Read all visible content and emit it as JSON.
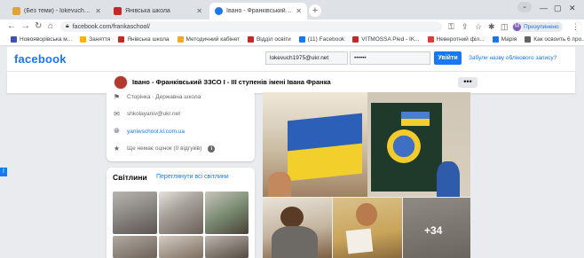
{
  "browser": {
    "tabs": [
      {
        "title": "(Без теми) - lokevuch1975@ukr.n",
        "active": false,
        "favicon_color": "#e5a234"
      },
      {
        "title": "Янівська школа",
        "active": false,
        "favicon_color": "#c62828"
      },
      {
        "title": "Івано - Франківський ЗЗСО І - І",
        "active": true,
        "favicon_color": "#1877f2"
      }
    ],
    "new_tab": "+",
    "url": "facebook.com/frankaschool/",
    "profile_initial": "M",
    "profile_label": "Призупинено",
    "bookmarks": [
      {
        "label": "Новояворівська м...",
        "color": "#3f51b5"
      },
      {
        "label": "Заняття",
        "color": "#ffb300"
      },
      {
        "label": "Янівська школа",
        "color": "#c62828"
      },
      {
        "label": "Методичний кабінет",
        "color": "#f9a825"
      },
      {
        "label": "Відділ освіти",
        "color": "#c62828"
      },
      {
        "label": "(11) Facebook",
        "color": "#1877f2"
      },
      {
        "label": "VITMOSSA Pled - IK...",
        "color": "#c62828"
      },
      {
        "label": "Неверотний філ...",
        "color": "#e53935"
      },
      {
        "label": "Марія",
        "color": "#1877f2"
      },
      {
        "label": "Как освоить 6 про...",
        "color": "#5f6368"
      }
    ]
  },
  "facebook": {
    "logo": "facebook",
    "email_value": "lokevuch1975@ukr.net",
    "password_value": "••••••",
    "login_label": "Увійти",
    "forgot_label": "Забули назву облікового запису?",
    "page_name": "Івано - Франківський ЗЗСО І - ІІІ ступенів імені Івана Франка",
    "more_label": "•••",
    "info": {
      "category": "Сторінка · Державна школа",
      "email": "shkolayaniv@ukr.net",
      "website": "yaniwschool.kl.com.ua",
      "rating": "Ще немає оцінок (0 відгуків)",
      "rating_info": "i"
    },
    "photos": {
      "title": "Світлини",
      "see_all": "Переглянути всі світлини",
      "more_count": "+34"
    }
  }
}
